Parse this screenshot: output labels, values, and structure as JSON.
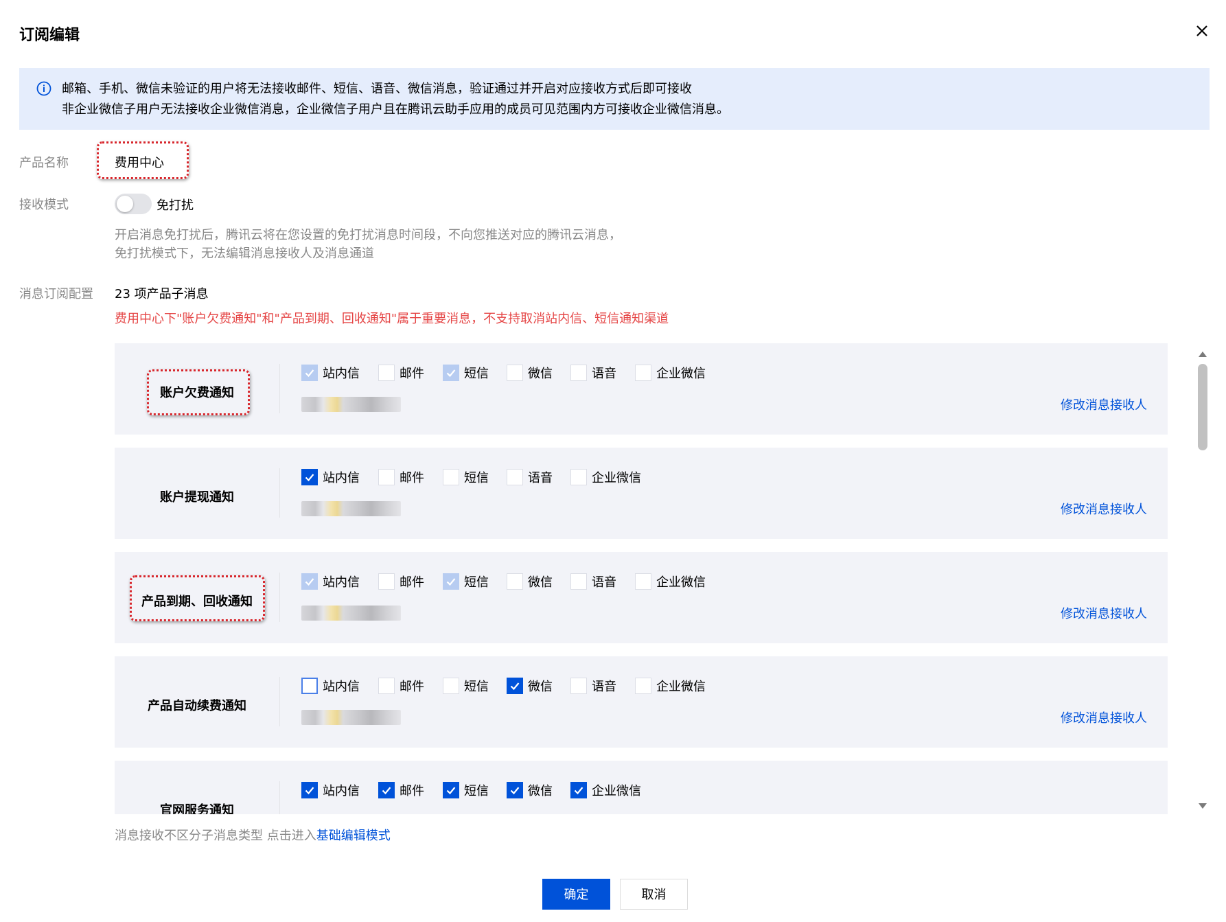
{
  "dialog": {
    "title": "订阅编辑"
  },
  "notice": {
    "line1": "邮箱、手机、微信未验证的用户将无法接收邮件、短信、语音、微信消息，验证通过并开启对应接收方式后即可接收",
    "line2": "非企业微信子用户无法接收企业微信消息，企业微信子用户且在腾讯云助手应用的成员可见范围内方可接收企业微信消息。"
  },
  "form": {
    "product_label": "产品名称",
    "product_value": "费用中心",
    "mode_label": "接收模式",
    "mode_toggle_label": "免打扰",
    "mode_toggle_on": false,
    "mode_desc1": "开启消息免打扰后，腾讯云将在您设置的免打扰消息时间段，不向您推送对应的腾讯云消息，",
    "mode_desc2": "免打扰模式下，无法编辑消息接收人及消息通道",
    "config_label": "消息订阅配置",
    "sub_count": "23 项产品子消息",
    "warning": "费用中心下\"账户欠费通知\"和\"产品到期、回收通知\"属于重要消息，不支持取消站内信、短信通知渠道"
  },
  "rows": [
    {
      "name": "账户欠费通知",
      "channels": [
        {
          "label": "站内信",
          "state": "checked-disabled"
        },
        {
          "label": "邮件",
          "state": "unchecked"
        },
        {
          "label": "短信",
          "state": "checked-disabled"
        },
        {
          "label": "微信",
          "state": "unchecked"
        },
        {
          "label": "语音",
          "state": "unchecked"
        },
        {
          "label": "企业微信",
          "state": "unchecked"
        }
      ],
      "modify": "修改消息接收人"
    },
    {
      "name": "账户提现通知",
      "channels": [
        {
          "label": "站内信",
          "state": "checked"
        },
        {
          "label": "邮件",
          "state": "unchecked"
        },
        {
          "label": "短信",
          "state": "unchecked"
        },
        {
          "label": "语音",
          "state": "unchecked"
        },
        {
          "label": "企业微信",
          "state": "unchecked"
        }
      ],
      "modify": "修改消息接收人"
    },
    {
      "name": "产品到期、回收通知",
      "channels": [
        {
          "label": "站内信",
          "state": "checked-disabled"
        },
        {
          "label": "邮件",
          "state": "unchecked"
        },
        {
          "label": "短信",
          "state": "checked-disabled"
        },
        {
          "label": "微信",
          "state": "unchecked"
        },
        {
          "label": "语音",
          "state": "unchecked"
        },
        {
          "label": "企业微信",
          "state": "unchecked"
        }
      ],
      "modify": "修改消息接收人"
    },
    {
      "name": "产品自动续费通知",
      "channels": [
        {
          "label": "站内信",
          "state": "focused"
        },
        {
          "label": "邮件",
          "state": "unchecked"
        },
        {
          "label": "短信",
          "state": "unchecked"
        },
        {
          "label": "微信",
          "state": "checked"
        },
        {
          "label": "语音",
          "state": "unchecked"
        },
        {
          "label": "企业微信",
          "state": "unchecked"
        }
      ],
      "modify": "修改消息接收人"
    },
    {
      "name": "官网服务通知",
      "channels": [
        {
          "label": "站内信",
          "state": "checked"
        },
        {
          "label": "邮件",
          "state": "checked"
        },
        {
          "label": "短信",
          "state": "checked"
        },
        {
          "label": "微信",
          "state": "checked"
        },
        {
          "label": "企业微信",
          "state": "checked"
        }
      ],
      "modify": ""
    }
  ],
  "footer": {
    "hint": "消息接收不区分子消息类型 点击进入",
    "link": "基础编辑模式",
    "ok": "确定",
    "cancel": "取消"
  },
  "colors": {
    "primary": "#0052d9",
    "notice_bg": "#e5edfc",
    "row_bg": "#f2f3f8",
    "warning": "#e54545",
    "annotation": "#d8262c"
  },
  "icons": {
    "close": "close-icon",
    "info": "info-icon",
    "check": "check-icon"
  }
}
